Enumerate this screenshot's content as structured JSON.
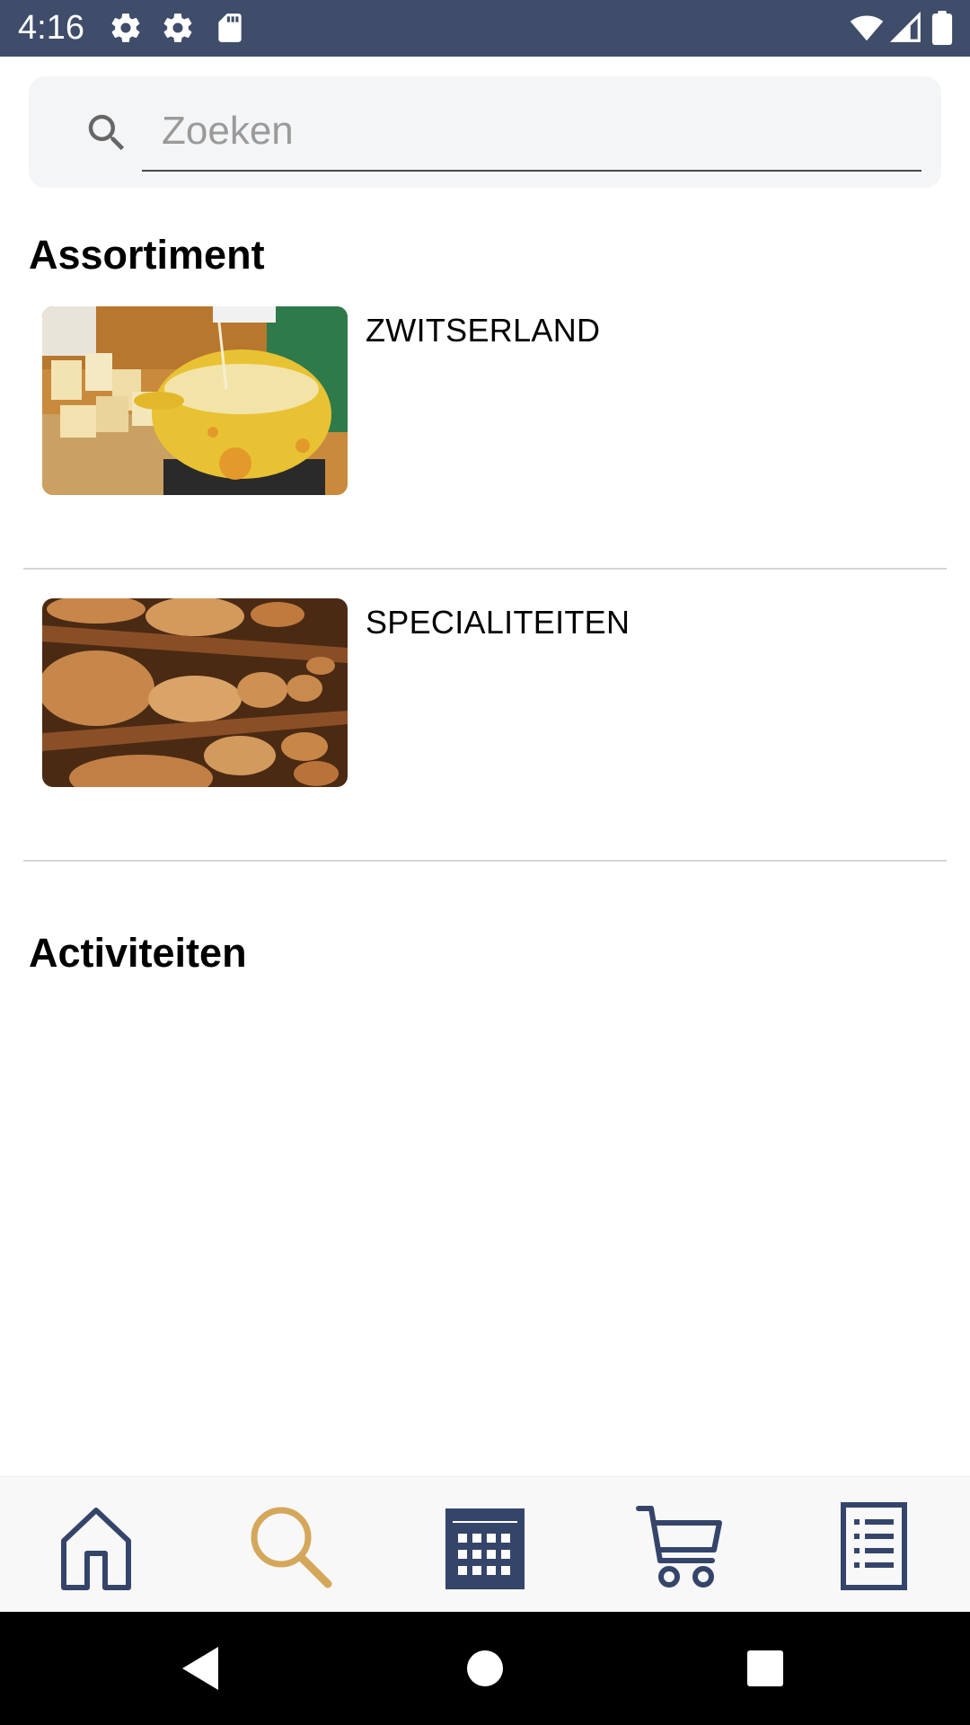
{
  "status_bar": {
    "time": "4:16",
    "icons": [
      "gear-icon",
      "gear-icon",
      "sd-card-icon",
      "wifi-icon",
      "signal-icon",
      "battery-icon"
    ]
  },
  "search": {
    "placeholder": "Zoeken",
    "value": ""
  },
  "sections": {
    "assortiment": {
      "title": "Assortiment",
      "items": [
        {
          "label": "ZWITSERLAND",
          "image": "fondue-pot-image"
        },
        {
          "label": "SPECIALITEITEN",
          "image": "cheese-wheels-shelf-image"
        }
      ]
    },
    "activiteiten": {
      "title": "Activiteiten"
    }
  },
  "bottom_nav": {
    "items": [
      {
        "icon": "home-icon",
        "active": false
      },
      {
        "icon": "search-icon",
        "active": true
      },
      {
        "icon": "calendar-icon",
        "active": false
      },
      {
        "icon": "cart-icon",
        "active": false
      },
      {
        "icon": "list-icon",
        "active": false
      }
    ]
  },
  "colors": {
    "status_bar": "#3f4d6b",
    "nav_icon": "#35456a",
    "nav_active": "#d4a75a"
  }
}
